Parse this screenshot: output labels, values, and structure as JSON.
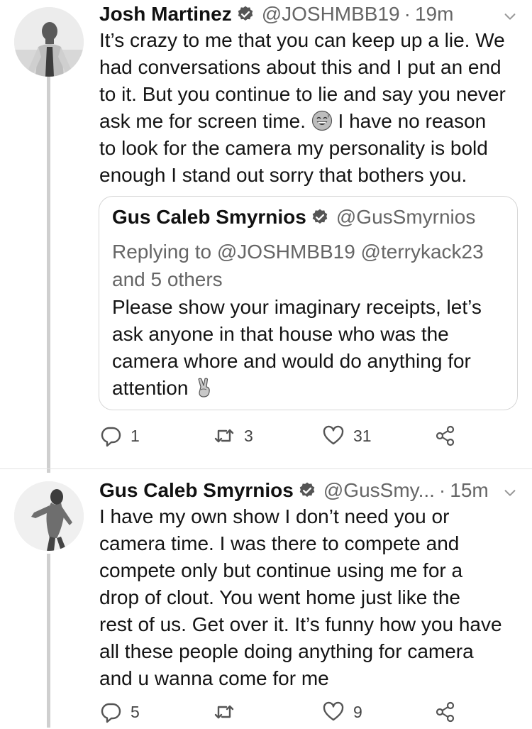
{
  "tweet1": {
    "name": "Josh Martinez",
    "handle": "@JOSHMBB19",
    "separator": "·",
    "time": "19m",
    "body_lines": [
      "It’s crazy to me that you can keep up a lie. We",
      "had conversations about this and I put an end",
      "to it. But you continue to lie and say you never",
      "ask me for screen time.",
      "I have no reason",
      "to look for the camera my personality is bold",
      "enough I stand out sorry that bothers you."
    ],
    "quoted": {
      "name": "Gus Caleb Smyrnios",
      "handle": "@GusSmyrnios",
      "reply_lines": [
        "Replying to @JOSHMBB19 @terrykack23",
        "and 5 others"
      ],
      "body_lines": [
        "Please show your imaginary receipts, let’s",
        "ask anyone in that house who was the",
        "camera whore and would do anything for",
        "attention"
      ]
    },
    "actions": {
      "replies": "1",
      "retweets": "3",
      "likes": "31"
    }
  },
  "tweet2": {
    "name": "Gus Caleb Smyrnios",
    "handle": "@GusSmy...",
    "separator": "·",
    "time": "15m",
    "body_lines": [
      "I have my own show I don’t need you or",
      "camera time. I was there to compete and",
      "compete only but continue using me for a",
      "drop of clout. You went home just like the",
      "rest of us. Get over it. It’s funny how you have",
      "all these people doing anything for camera",
      "and u wanna come for me"
    ],
    "actions": {
      "replies": "5",
      "retweets": "",
      "likes": "9"
    }
  },
  "icons": {
    "verified": "verified-badge-icon",
    "menu": "chevron-down-icon",
    "reply": "reply-icon",
    "retweet": "retweet-icon",
    "like": "heart-icon",
    "share": "share-icon",
    "emoji1": "grinning-sweat-emoji",
    "emoji2": "victory-hand-emoji"
  }
}
